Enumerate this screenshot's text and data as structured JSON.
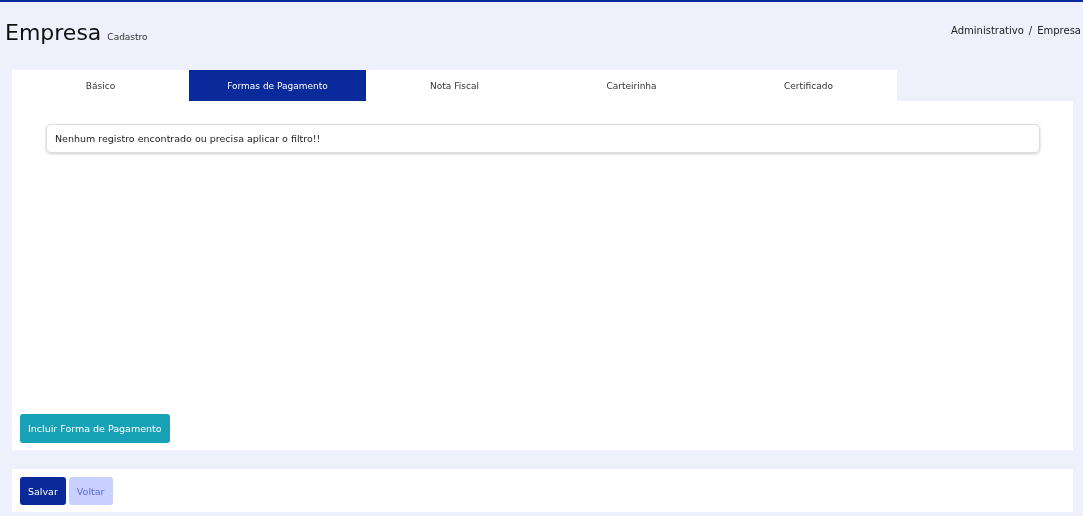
{
  "page": {
    "title": "Empresa",
    "subtitle": "Cadastro"
  },
  "breadcrumb": {
    "separator": "/",
    "items": [
      "Administrativo",
      "Empresa"
    ]
  },
  "tabs": [
    {
      "label": "Básico",
      "selected": false
    },
    {
      "label": "Formas de Pagamento",
      "selected": true
    },
    {
      "label": "Nota Fiscal",
      "selected": false
    },
    {
      "label": "Carteirinha",
      "selected": false
    },
    {
      "label": "Certificado",
      "selected": false
    }
  ],
  "message": "Nenhum registro encontrado ou precisa aplicar o filtro!!",
  "add_button": "Incluir Forma de Pagamento",
  "footer_buttons": [
    {
      "label": "Salvar",
      "kind": "primary"
    },
    {
      "label": "Voltar",
      "kind": "secondary"
    }
  ]
}
